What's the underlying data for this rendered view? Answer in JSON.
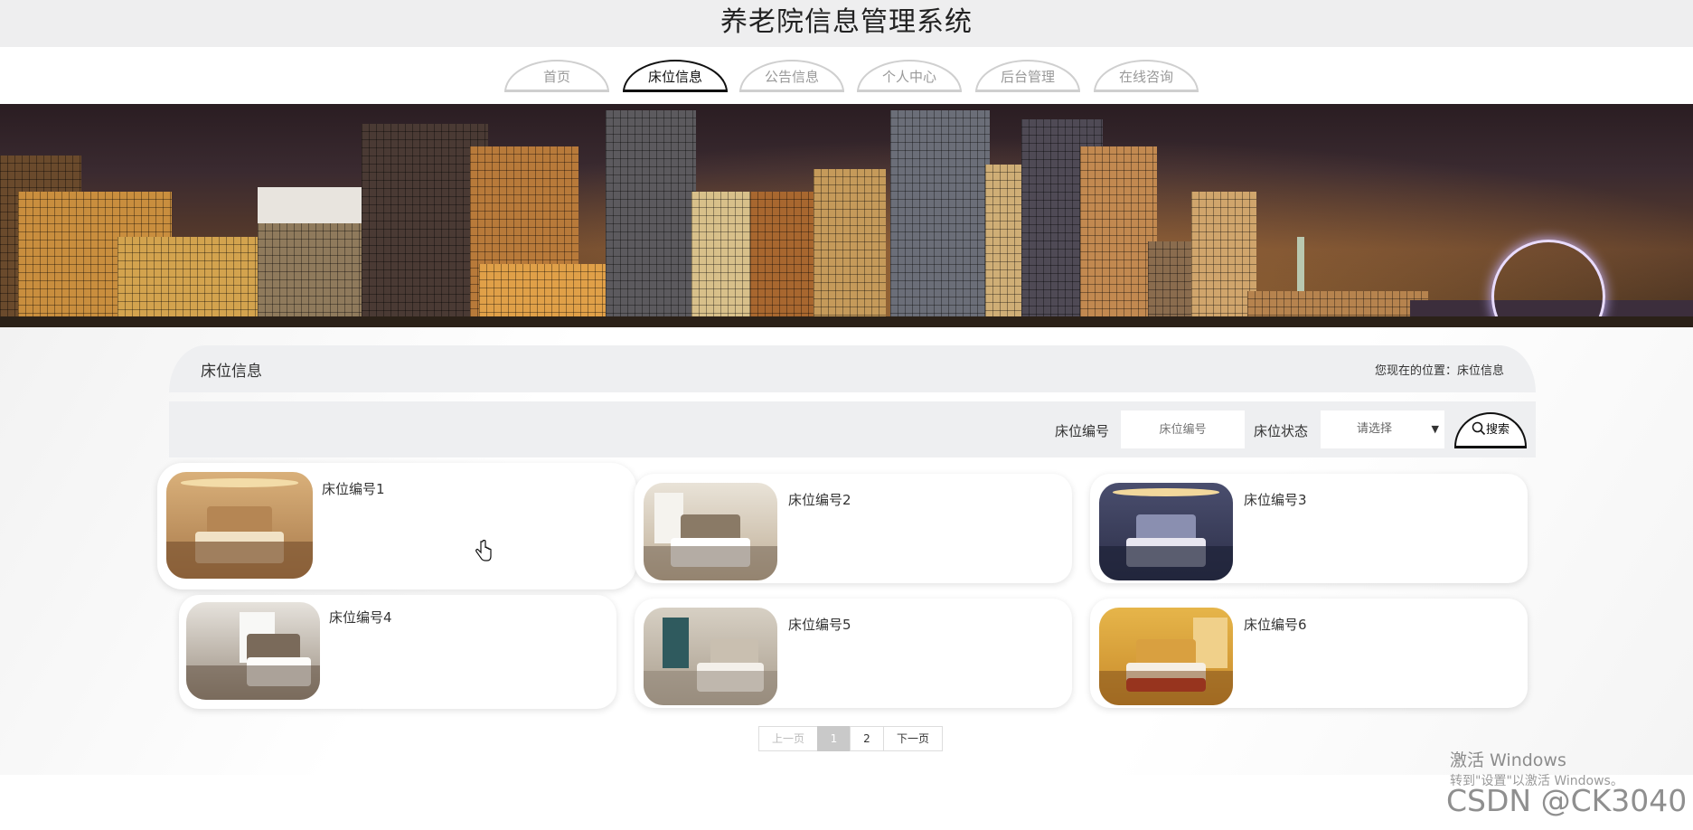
{
  "header": {
    "site_title": "养老院信息管理系统"
  },
  "nav": {
    "items": [
      {
        "label": "首页",
        "active": false
      },
      {
        "label": "床位信息",
        "active": true
      },
      {
        "label": "公告信息",
        "active": false
      },
      {
        "label": "个人中心",
        "active": false
      },
      {
        "label": "后台管理",
        "active": false
      },
      {
        "label": "在线咨询",
        "active": false
      }
    ]
  },
  "section": {
    "title": "床位信息",
    "breadcrumb_prefix": "您现在的位置：",
    "breadcrumb_current": "床位信息"
  },
  "search": {
    "bed_number_label": "床位编号",
    "bed_number_placeholder": "床位编号",
    "bed_status_label": "床位状态",
    "bed_status_selected": "请选择",
    "search_button_label": "搜索",
    "search_icon": "search-icon"
  },
  "beds": [
    {
      "name": "床位编号1"
    },
    {
      "name": "床位编号2"
    },
    {
      "name": "床位编号3"
    },
    {
      "name": "床位编号4"
    },
    {
      "name": "床位编号5"
    },
    {
      "name": "床位编号6"
    }
  ],
  "pagination": {
    "prev_label": "上一页",
    "pages": [
      "1",
      "2"
    ],
    "current_page": "1",
    "next_label": "下一页"
  },
  "overlay": {
    "activate_windows_title": "激活 Windows",
    "activate_windows_hint": "转到\"设置\"以激活 Windows。",
    "csdn_watermark": "CSDN @CK3040"
  },
  "colors": {
    "active_nav": "#111111",
    "inactive_nav": "#cfcfcf",
    "panel_bg": "#eeeff1"
  }
}
